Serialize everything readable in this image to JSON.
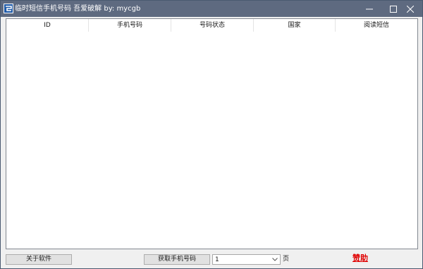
{
  "window": {
    "title": "临时短信手机号码 吾爱破解 by: mycgb"
  },
  "table": {
    "columns": [
      "ID",
      "手机号码",
      "号码状态",
      "国家",
      "阅读短信"
    ],
    "rows": []
  },
  "footer": {
    "about_label": "关于软件",
    "get_number_label": "获取手机号码",
    "page_value": "1",
    "page_suffix": "页",
    "donate_label": "赞助"
  },
  "colors": {
    "titlebar": "#5e6a80",
    "donate": "#e00000"
  }
}
